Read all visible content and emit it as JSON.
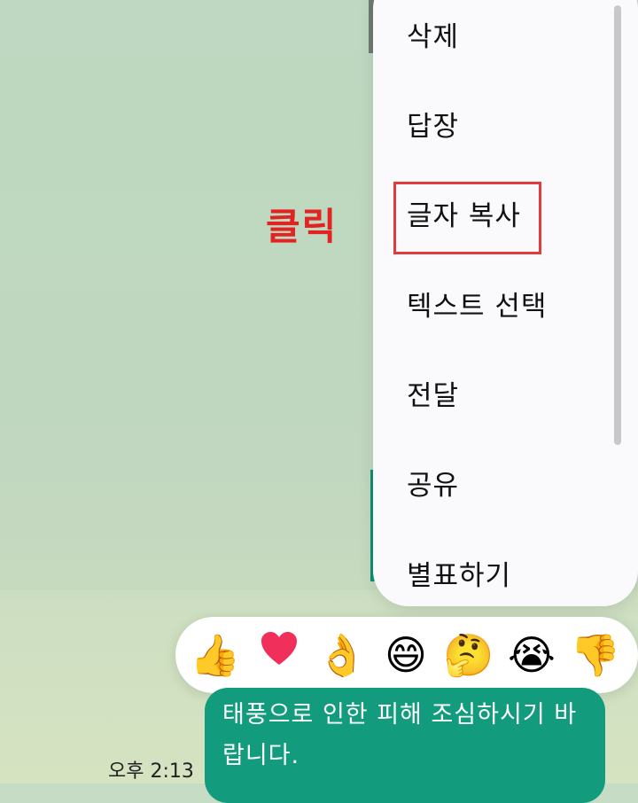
{
  "context_menu": {
    "items": [
      {
        "label": "삭제"
      },
      {
        "label": "답장"
      },
      {
        "label": "글자 복사"
      },
      {
        "label": "텍스트 선택"
      },
      {
        "label": "전달"
      },
      {
        "label": "공유"
      },
      {
        "label": "별표하기"
      }
    ]
  },
  "annotation": {
    "click_label": "클릭",
    "highlight_color": "#e23b3b"
  },
  "reactions": [
    {
      "icon": "thumbs-up-icon",
      "glyph": "👍"
    },
    {
      "icon": "heart-icon",
      "glyph": "❤"
    },
    {
      "icon": "ok-hand-icon",
      "glyph": "👌"
    },
    {
      "icon": "grinning-face-icon",
      "glyph": "😄"
    },
    {
      "icon": "thinking-face-icon",
      "glyph": "🤔"
    },
    {
      "icon": "crying-face-icon",
      "glyph": "😭"
    },
    {
      "icon": "thumbs-down-icon",
      "glyph": "👎"
    }
  ],
  "message": {
    "text": "태풍으로 인한 피해 조심하시기 바랍니다.",
    "timestamp": "오후 2:13",
    "bubble_color": "#129c7d"
  }
}
